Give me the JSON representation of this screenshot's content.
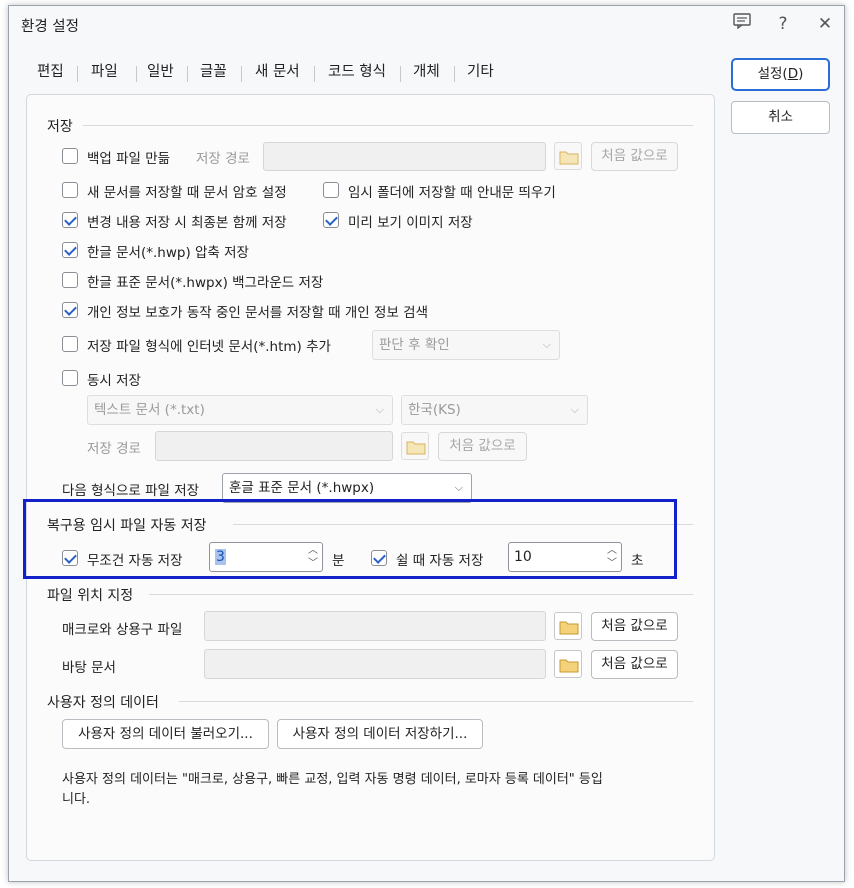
{
  "window": {
    "title": "환경 설정"
  },
  "titlebar": {
    "help_label": "?",
    "close_label": "✕"
  },
  "tabs": [
    {
      "label": "편집"
    },
    {
      "label": "파일"
    },
    {
      "label": "일반"
    },
    {
      "label": "글꼴"
    },
    {
      "label": "새 문서"
    },
    {
      "label": "코드 형식"
    },
    {
      "label": "개체"
    },
    {
      "label": "기타"
    }
  ],
  "active_tab": "파일",
  "buttons": {
    "ok": "설정(D)",
    "ok_prefix": "설정(",
    "ok_mnemonic": "D",
    "ok_suffix": ")",
    "cancel": "취소"
  },
  "save": {
    "title": "저장",
    "backup": {
      "label": "백업 파일 만듦",
      "checked": false,
      "path_label": "저장 경로",
      "path_value": "",
      "reset": "처음 값으로"
    },
    "encrypt": {
      "label": "새 문서를 저장할 때 문서 암호 설정",
      "checked": false
    },
    "temp_notice": {
      "label": "임시 폴더에 저장할 때 안내문 띄우기",
      "checked": false
    },
    "keep_final": {
      "label": "변경 내용 저장 시 최종본 함께 저장",
      "checked": true
    },
    "preview_image": {
      "label": "미리 보기 이미지 저장",
      "checked": true
    },
    "compress_hwp": {
      "label": "한글 문서(*.hwp) 압축 저장",
      "checked": true
    },
    "background_hwpx": {
      "label": "한글 표준 문서(*.hwpx) 백그라운드 저장",
      "checked": false
    },
    "privacy_search": {
      "label": "개인 정보 보호가 동작 중인 문서를 저장할 때 개인 정보 검색",
      "checked": true
    },
    "add_htm": {
      "label": "저장 파일 형식에 인터넷 문서(*.htm) 추가",
      "checked": false,
      "combo": "판단 후 확인"
    },
    "simultaneous": {
      "label": "동시 저장",
      "checked": false,
      "format": "텍스트 문서 (*.txt)",
      "encoding": "한국(KS)",
      "path_label": "저장 경로",
      "reset": "처음 값으로"
    },
    "save_as": {
      "label": "다음 형식으로 파일 저장",
      "value": "훈글 표준 문서 (*.hwpx)"
    }
  },
  "autosave": {
    "title": "복구용 임시 파일 자동 저장",
    "always": {
      "label": "무조건 자동 저장",
      "checked": true,
      "value": "3",
      "unit": "분"
    },
    "idle": {
      "label": "쉴 때 자동 저장",
      "checked": true,
      "value": "10",
      "unit": "초"
    }
  },
  "locations": {
    "title": "파일 위치 지정",
    "macro": {
      "label": "매크로와 상용구 파일",
      "value": "",
      "reset": "처음 값으로"
    },
    "desktop": {
      "label": "바탕 문서",
      "value": "",
      "reset": "처음 값으로"
    }
  },
  "user_data": {
    "title": "사용자 정의 데이터",
    "load": "사용자 정의 데이터 불러오기...",
    "save": "사용자 정의 데이터 저장하기...",
    "description_line1": "사용자 정의 데이터는 \"매크로, 상용구, 빠른 교정, 입력 자동 명령 데이터, 로마자 등록 데이터\" 등입",
    "description_line2": "니다."
  },
  "colors": {
    "accent": "#2b6cd6",
    "highlight_box": "#1322c8"
  }
}
